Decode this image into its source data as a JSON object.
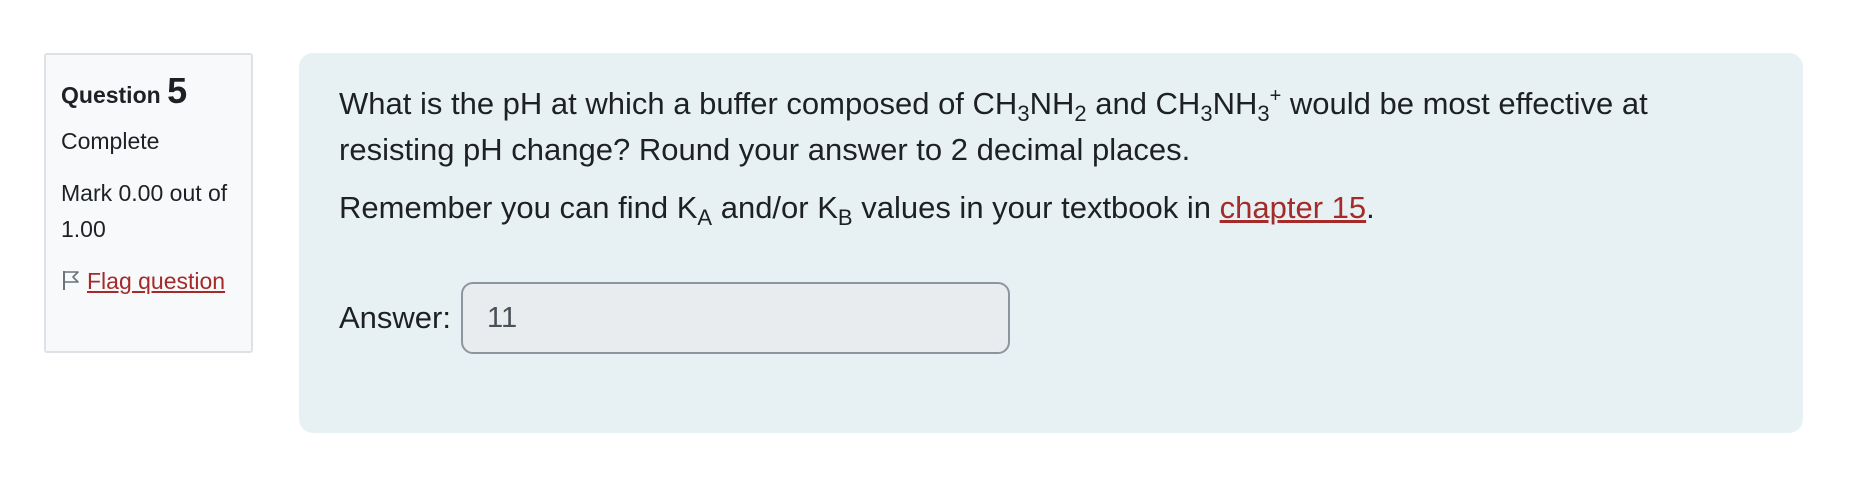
{
  "info": {
    "question_label": "Question",
    "question_number": "5",
    "state": "Complete",
    "grade": "Mark 0.00 out of 1.00",
    "flag_label": "Flag question",
    "flag_icon": "flag-outline-icon"
  },
  "question": {
    "text_part1": "What is the pH at which a buffer composed of CH",
    "sub1": "3",
    "text_part2": "NH",
    "sub2": "2",
    "text_part3": " and CH",
    "sub3": "3",
    "text_part4": "NH",
    "sub4": "3",
    "sup1": "+",
    "text_part5": " would be most effective at resisting pH change? Round your answer to 2 decimal places.",
    "remember_part1": "Remember you can find K",
    "remember_sub1": "A",
    "remember_part2": " and/or K",
    "remember_sub2": "B",
    "remember_part3": " values in your textbook in ",
    "link_text": "chapter 15",
    "remember_part4": "."
  },
  "answer": {
    "label": "Answer:",
    "value": "11"
  },
  "colors": {
    "link": "#a52a2a",
    "content_bg": "#e7f1f3",
    "info_bg": "#f8f9fa",
    "input_bg": "#e9ecef"
  }
}
